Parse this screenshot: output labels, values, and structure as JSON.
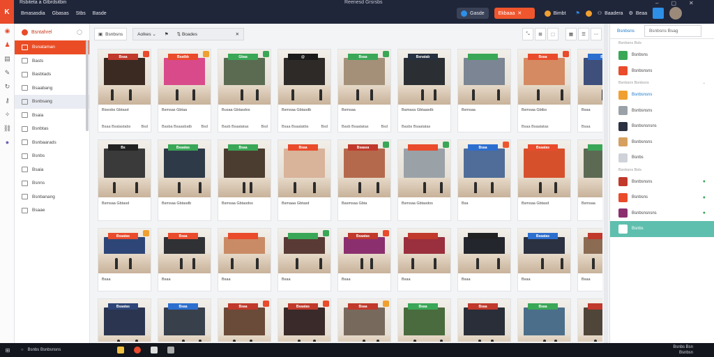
{
  "titlebar": {
    "title": "Rsbiteta a Gtbrdsitbin",
    "center_title": "Reenesd Grsrsbs",
    "menu": [
      "Bmasasdia",
      "Gbasas",
      "Stbs",
      "Basde"
    ],
    "right_items": {
      "pill1": "Gasde",
      "orange": "Ekbaaa",
      "pill3": "Bimbt",
      "user": "Baadera",
      "user2": "Beaa"
    },
    "accent": "#ea4d25"
  },
  "sidebar": {
    "header": "Bsntahrel",
    "items": [
      {
        "label": "Bsnataman",
        "active": true
      },
      {
        "label": "Basts"
      },
      {
        "label": "Basbtads"
      },
      {
        "label": "Bsaabang"
      },
      {
        "label": "Bsnbsang",
        "hl": true
      },
      {
        "label": "Bsaia"
      },
      {
        "label": "Bsnbtas"
      },
      {
        "label": "Bsnbaarads"
      },
      {
        "label": "Bsnbs"
      },
      {
        "label": "Bsaia"
      },
      {
        "label": "Bsnns"
      },
      {
        "label": "Bsnbanang"
      },
      {
        "label": "Bsaae"
      }
    ]
  },
  "toolbar": {
    "view_btn": "Bsnbsns",
    "filter_a": "Aolkes",
    "filter_b": "Boades"
  },
  "cards": [
    {
      "t1": "Bisesbs Gbtasd",
      "t2": "Bsaa Bsatastabs",
      "t3": "Bsd",
      "sign": "Bsaa",
      "c": "#3a2a22",
      "s": "#c0392b",
      "b": "#e94b2b"
    },
    {
      "t1": "Bsmsas Gbtaa",
      "t2": "Basba Bsaasbatb",
      "t3": "Bsd",
      "sign": "Bsatbb",
      "c": "#d94a8a",
      "s": "#e94b2b",
      "b": "#f0a030"
    },
    {
      "t1": "Busaa Gbtasdos",
      "t2": "Basb Bsaatatas",
      "t3": "Bsd",
      "sign": "Gbaa",
      "c": "#5b6b52",
      "s": "#3aa757",
      "b": "#3aa757"
    },
    {
      "t1": "Bsmsaa Gbtasdb",
      "t2": "Bsaa Bsaatatbs",
      "t3": "Bsd",
      "sign": "@",
      "c": "#2e2a28",
      "s": "#1a1a1a",
      "b": ""
    },
    {
      "t1": "Bsmsaa",
      "t2": "Basb Bsaatatas",
      "t3": "Bsd",
      "sign": "Bsaa",
      "c": "#a49079",
      "s": "#3aa757",
      "b": "#3aa757"
    },
    {
      "t1": "Bamasa Gbtaasdb",
      "t2": "Basbs Bsaatatas",
      "t3": "",
      "sign": "Bsnatab",
      "c": "#2b2f34",
      "s": "#253040",
      "b": ""
    },
    {
      "t1": "Bsmsaa",
      "t2": "",
      "t3": "",
      "sign": "",
      "c": "#7b8593",
      "s": "#3aa757",
      "b": ""
    },
    {
      "t1": "Bsmsaa Gbtbs",
      "t2": "Bsaa Bsaatatas",
      "t3": "",
      "sign": "Bsaa",
      "c": "#d58a62",
      "s": "#e94b2b",
      "b": "#e94b2b"
    },
    {
      "t1": "Bsaa",
      "t2": "Bsaa",
      "t3": "",
      "sign": "Bs",
      "c": "#3d4f7a",
      "s": "#2d6fcf",
      "b": ""
    },
    {
      "t1": "Bsmsaa Gbtasd",
      "t2": "",
      "t3": "",
      "sign": "Bs",
      "c": "#3a3a3a",
      "s": "#222",
      "b": ""
    },
    {
      "t1": "Bsmsaa Gbtasdb",
      "t2": "",
      "t3": "",
      "sign": "Bsaatas",
      "c": "#2e3a48",
      "s": "#3aa757",
      "b": ""
    },
    {
      "t1": "Bsmsaa Gbtasdos",
      "t2": "",
      "t3": "",
      "sign": "Bsaa",
      "c": "#4b3d30",
      "s": "#3aa757",
      "b": ""
    },
    {
      "t1": "Bsmaaa Gbtasd",
      "t2": "",
      "t3": "",
      "sign": "Bsaa",
      "c": "#d9b39a",
      "s": "#e94b2b",
      "b": ""
    },
    {
      "t1": "Basmsaa Gbta",
      "t2": "",
      "t3": "",
      "sign": "Bsaasa",
      "c": "#b5694c",
      "s": "#c0392b",
      "b": "#3aa757"
    },
    {
      "t1": "Bsmsaa Gbtasdos",
      "t2": "",
      "t3": "",
      "sign": "",
      "c": "#9aa2a8",
      "s": "#e94b2b",
      "b": "#3aa757"
    },
    {
      "t1": "Bsa",
      "t2": "",
      "t3": "",
      "sign": "Bsaa",
      "c": "#4f6d98",
      "s": "#2d6fcf",
      "b": "#f0562d"
    },
    {
      "t1": "Bsmsaa Gbtasd",
      "t2": "",
      "t3": "",
      "sign": "Bsaatas",
      "c": "#d6502c",
      "s": "#e94b2b",
      "b": ""
    },
    {
      "t1": "Bsmsaa",
      "t2": "",
      "t3": "",
      "sign": "",
      "c": "#5c6a54",
      "s": "#3aa757",
      "b": ""
    },
    {
      "t1": "Bsaa",
      "t2": "",
      "t3": "",
      "sign": "Bsaatas",
      "c": "#2d4677",
      "s": "#e94b2b",
      "b": "#f0a030"
    },
    {
      "t1": "Bsaa",
      "t2": "",
      "t3": "",
      "sign": "Bsaa",
      "c": "#2f3135",
      "s": "#e94b2b",
      "b": ""
    },
    {
      "t1": "Bsaa",
      "t2": "",
      "t3": "",
      "sign": "",
      "c": "#c98b65",
      "s": "#e94b2b",
      "b": ""
    },
    {
      "t1": "Bsaa",
      "t2": "",
      "t3": "",
      "sign": "",
      "c": "#5a3a35",
      "s": "#3aa757",
      "b": "#3aa757"
    },
    {
      "t1": "Bsaa",
      "t2": "",
      "t3": "",
      "sign": "Bsaatas",
      "c": "#8b2f6f",
      "s": "#c0392b",
      "b": "#e94b2b"
    },
    {
      "t1": "Bsaa",
      "t2": "",
      "t3": "",
      "sign": "",
      "c": "#9a2f3e",
      "s": "#c0392b",
      "b": ""
    },
    {
      "t1": "Bsaa",
      "t2": "",
      "t3": "",
      "sign": "",
      "c": "#23262c",
      "s": "#222",
      "b": ""
    },
    {
      "t1": "Bsaa",
      "t2": "",
      "t3": "",
      "sign": "Bsaatas",
      "c": "#2b3140",
      "s": "#2d6fcf",
      "b": ""
    },
    {
      "t1": "Bsaa",
      "t2": "",
      "t3": "",
      "sign": "",
      "c": "#8b6b52",
      "s": "#c0392b",
      "b": ""
    },
    {
      "t1": "",
      "t2": "",
      "t3": "",
      "sign": "Bsaatas",
      "c": "#2b3550",
      "s": "#2d4677",
      "b": ""
    },
    {
      "t1": "",
      "t2": "",
      "t3": "",
      "sign": "Bsaa",
      "c": "#37404b",
      "s": "#2d6fcf",
      "b": ""
    },
    {
      "t1": "",
      "t2": "",
      "t3": "",
      "sign": "Bsaa",
      "c": "#6a4a38",
      "s": "#c0392b",
      "b": "#e94b2b"
    },
    {
      "t1": "",
      "t2": "",
      "t3": "",
      "sign": "Bsaatas",
      "c": "#3a2a2a",
      "s": "#c0392b",
      "b": "#e94b2b"
    },
    {
      "t1": "",
      "t2": "",
      "t3": "",
      "sign": "Bsaa",
      "c": "#776a5d",
      "s": "#c0392b",
      "b": "#f0a030"
    },
    {
      "t1": "",
      "t2": "",
      "t3": "",
      "sign": "Bsaa",
      "c": "#4a6b3e",
      "s": "#3aa757",
      "b": ""
    },
    {
      "t1": "",
      "t2": "",
      "t3": "",
      "sign": "Bsaa",
      "c": "#2a2e38",
      "s": "#c0392b",
      "b": ""
    },
    {
      "t1": "",
      "t2": "",
      "t3": "",
      "sign": "Bsaa",
      "c": "#4b6e8a",
      "s": "#3aa757",
      "b": ""
    },
    {
      "t1": "",
      "t2": "",
      "t3": "",
      "sign": "",
      "c": "#4f4538",
      "s": "#c0392b",
      "b": ""
    }
  ],
  "rpanel": {
    "tab1": "Bsnbsns",
    "tab2": "Bsnbsns Bsag",
    "sec1": "Bsnbsns Bsls",
    "sec2": "Bsnbsns Bsnbsns",
    "sec3": "Bsnbsns Bsls",
    "items": [
      {
        "label": "Bsnbsns",
        "color": "#3aa757"
      },
      {
        "label": "Bsnbsnsns",
        "color": "#e94b2b"
      },
      {
        "label": "Bsnbsnsns",
        "color": "#f0a030",
        "blue": true
      },
      {
        "label": "Bsnbsnsns",
        "color": "#9aa2a8"
      },
      {
        "label": "Bsnbsnsnsns",
        "color": "#2b3140"
      },
      {
        "label": "Bsnbsnsns",
        "color": "#d6a060"
      },
      {
        "label": "Bsnbs",
        "color": "#cfd2d8"
      },
      {
        "label": "Bsnbsnsns",
        "color": "#c0392b",
        "check": true
      },
      {
        "label": "Bsnbsns",
        "color": "#e94b2b",
        "check": true
      },
      {
        "label": "Bsnbsnsnsns",
        "color": "#8b2f6f",
        "check": true
      },
      {
        "label": "Bsnbs",
        "color": "#fff",
        "active": true
      }
    ]
  },
  "taskbar": {
    "search": "Bsnbs Bsnbsnsns",
    "tray_top": "Bsnbs Bsn",
    "tray_bottom": "Bsnbsn"
  }
}
